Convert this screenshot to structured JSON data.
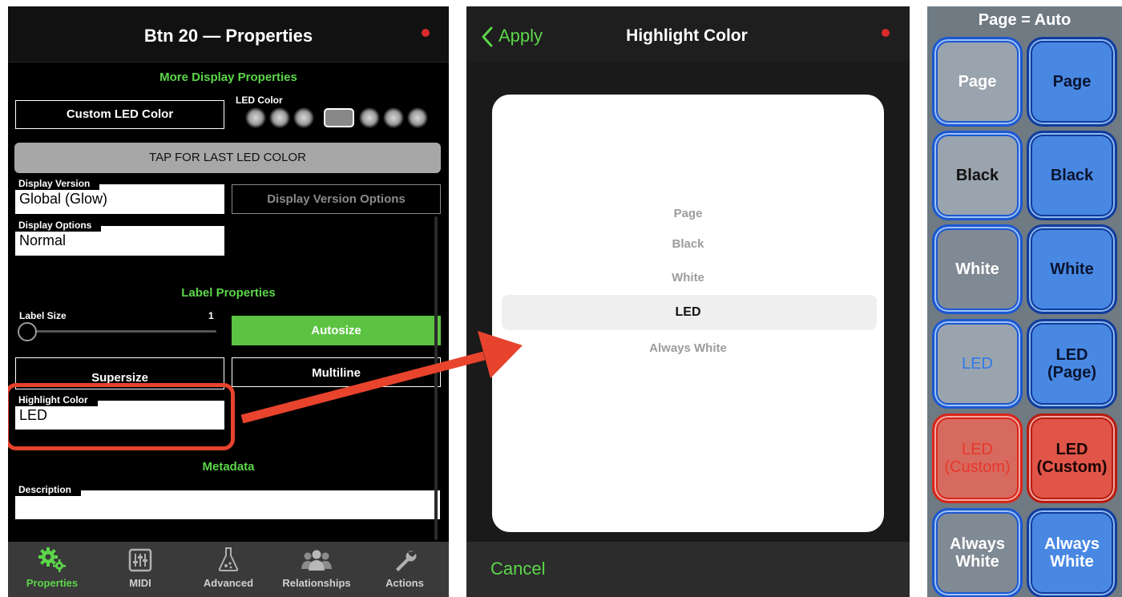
{
  "panel1": {
    "title": "Btn 20 — Properties",
    "more_display_title": "More Display Properties",
    "custom_led_color_button": "Custom LED Color",
    "led_color_label": "LED Color",
    "tap_last_led": "TAP FOR LAST LED COLOR",
    "display_version_label": "Display Version",
    "display_version_value": "Global (Glow)",
    "display_version_options": "Display Version Options",
    "display_options_label": "Display Options",
    "display_options_value": "Normal",
    "label_properties_title": "Label Properties",
    "label_size_label": "Label Size",
    "label_size_value": "1",
    "autosize_button": "Autosize",
    "supersize_button": "Supersize",
    "multiline_button": "Multiline",
    "highlight_color_label": "Highlight Color",
    "highlight_color_value": "LED",
    "metadata_title": "Metadata",
    "description_label": "Description",
    "description_value": "",
    "tabs": [
      {
        "label": "Properties",
        "icon": "gears-icon",
        "active": true
      },
      {
        "label": "MIDI",
        "icon": "mixer-icon",
        "active": false
      },
      {
        "label": "Advanced",
        "icon": "flask-icon",
        "active": false
      },
      {
        "label": "Relationships",
        "icon": "people-icon",
        "active": false
      },
      {
        "label": "Actions",
        "icon": "wrench-icon",
        "active": false
      }
    ]
  },
  "panel2": {
    "back_label": "Apply",
    "title": "Highlight Color",
    "options": [
      "Page",
      "Black",
      "White",
      "LED",
      "Always White"
    ],
    "selected": "LED",
    "cancel_label": "Cancel"
  },
  "panel3": {
    "title": "Page = Auto",
    "pads_left": [
      "Page",
      "Black",
      "White",
      "LED",
      "LED\n(Custom)",
      "Always\nWhite"
    ],
    "pads_right": [
      "Page",
      "Black",
      "White",
      "LED\n(Page)",
      "LED\n(Custom)",
      "Always\nWhite"
    ]
  },
  "colors": {
    "accent_green": "#5cd64a",
    "annotation_red": "#e8432d",
    "pad_blue": "#4888e3",
    "pad_red": "#d76a5f"
  }
}
